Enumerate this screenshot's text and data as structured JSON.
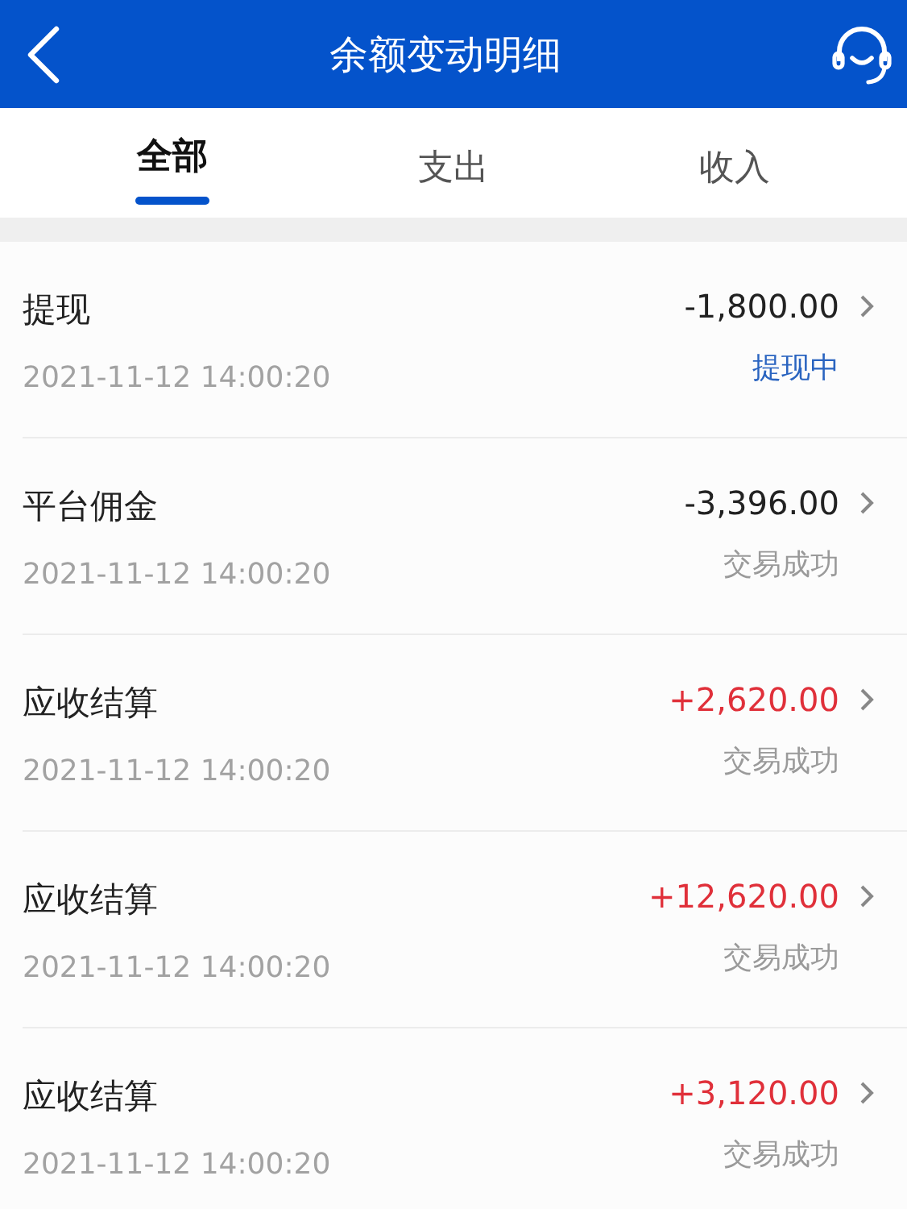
{
  "header": {
    "title": "余额变动明细"
  },
  "tabs": [
    {
      "label": "全部",
      "selected": true
    },
    {
      "label": "支出",
      "selected": false
    },
    {
      "label": "收入",
      "selected": false
    }
  ],
  "records": [
    {
      "title": "提现",
      "time": "2021-11-12 14:00:20",
      "amount": "-1,800.00",
      "kind": "expense",
      "status": "提现中",
      "pending": true
    },
    {
      "title": "平台佣金",
      "time": "2021-11-12 14:00:20",
      "amount": "-3,396.00",
      "kind": "expense",
      "status": "交易成功",
      "pending": false
    },
    {
      "title": "应收结算",
      "time": "2021-11-12 14:00:20",
      "amount": "+2,620.00",
      "kind": "income",
      "status": "交易成功",
      "pending": false
    },
    {
      "title": "应收结算",
      "time": "2021-11-12 14:00:20",
      "amount": "+12,620.00",
      "kind": "income",
      "status": "交易成功",
      "pending": false
    },
    {
      "title": "应收结算",
      "time": "2021-11-12 14:00:20",
      "amount": "+3,120.00",
      "kind": "income",
      "status": "交易成功",
      "pending": false
    }
  ]
}
